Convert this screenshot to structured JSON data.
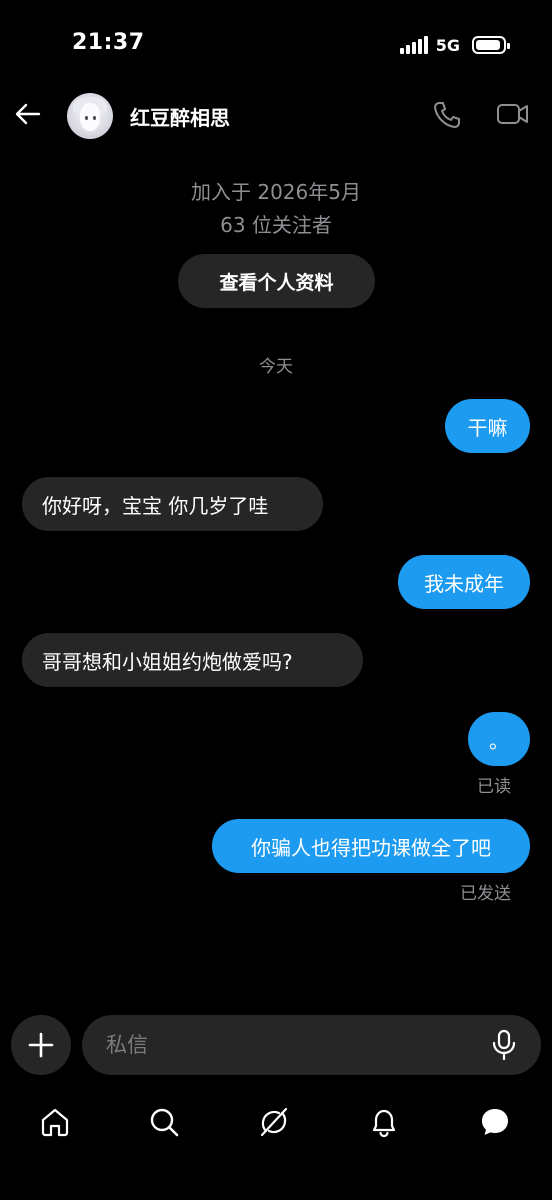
{
  "status_bar": {
    "time": "21:37",
    "network": "5G",
    "icons": [
      "signal-icon",
      "battery-icon"
    ]
  },
  "header": {
    "contact_name": "红豆醉相思",
    "icons": [
      "back-arrow-icon",
      "avatar",
      "phone-icon",
      "video-icon"
    ]
  },
  "profile": {
    "joined": "加入于 2026年5月",
    "followers": "63 位关注者",
    "view_profile_label": "查看个人资料"
  },
  "date_separator": "今天",
  "messages": [
    {
      "direction": "outgoing",
      "text": "干嘛"
    },
    {
      "direction": "incoming",
      "text": "你好呀，宝宝 你几岁了哇"
    },
    {
      "direction": "outgoing",
      "text": "我未成年"
    },
    {
      "direction": "incoming",
      "text": "哥哥想和小姐姐约炮做爱吗?"
    },
    {
      "direction": "outgoing",
      "text": "。",
      "receipt": "已读"
    },
    {
      "direction": "outgoing",
      "text": "你骗人也得把功课做全了吧",
      "receipt": "已发送"
    }
  ],
  "composer": {
    "placeholder": "私信",
    "value": "",
    "icons": [
      "plus-icon",
      "microphone-icon"
    ]
  },
  "bottom_nav": {
    "icons": [
      "home-icon",
      "search-icon",
      "grok-icon",
      "notifications-bell-icon",
      "messages-icon"
    ],
    "active": "messages-icon"
  },
  "colors": {
    "background": "#000000",
    "outgoing_bubble": "#1d9bf0",
    "incoming_bubble": "#262626",
    "secondary_text": "#8e8e93"
  }
}
